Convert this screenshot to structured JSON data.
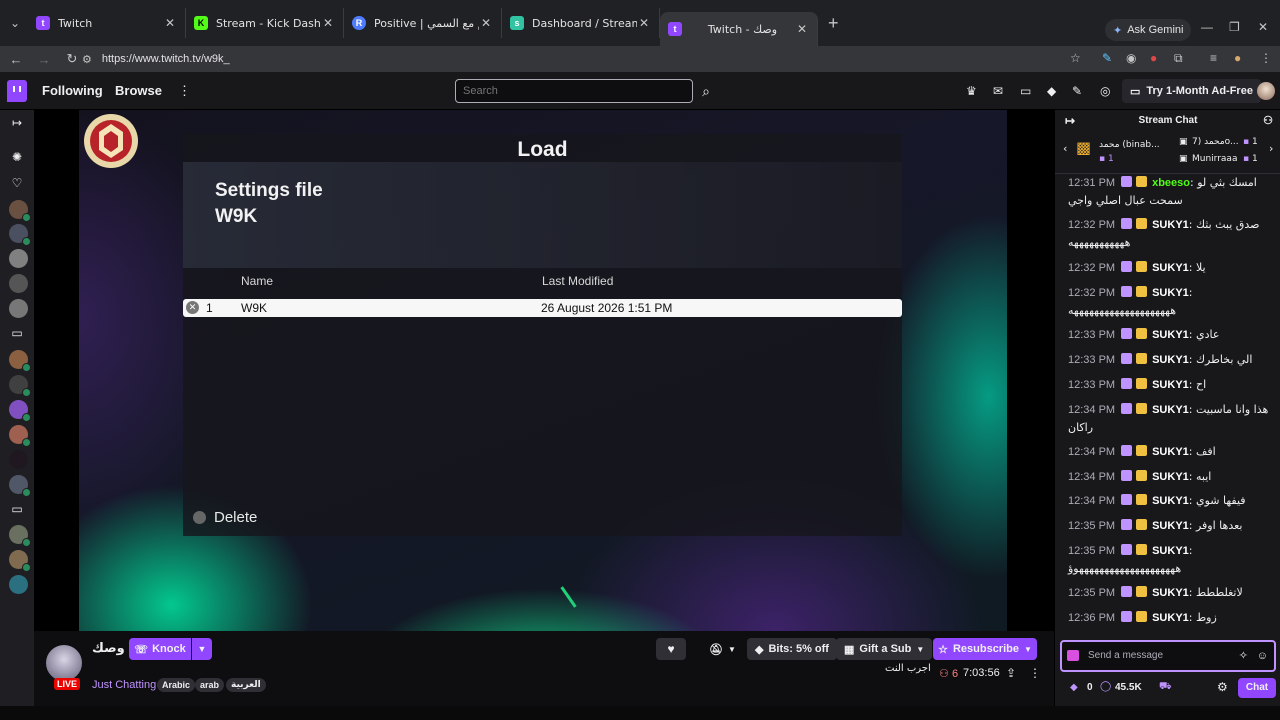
{
  "browser": {
    "tabs": [
      {
        "title": "Twitch",
        "fav_color": "#9147ff",
        "fav_letter": "t"
      },
      {
        "title": "Stream - Kick Dashboard",
        "fav_color": "#53fc18",
        "fav_letter": "K"
      },
      {
        "title": "Positive | النبي تختيم مع السمي",
        "fav_color": "#4f7cff",
        "fav_letter": "R"
      },
      {
        "title": "Dashboard / Streamlabs",
        "fav_color": "#31c3a2",
        "fav_letter": "s"
      },
      {
        "title": "Twitch - وصك",
        "fav_color": "#9147ff",
        "fav_letter": "t"
      }
    ],
    "new_tab": "+",
    "ask_gemini": "Ask Gemini",
    "url": "https://www.twitch.tv/w9k_"
  },
  "twitch_top": {
    "following": "Following",
    "browse": "Browse",
    "search_placeholder": "Search",
    "ad_free": "Try 1-Month Ad-Free"
  },
  "game": {
    "load_title": "Load",
    "settings_title_1": "Settings file",
    "settings_title_2": "W9K",
    "col_name": "Name",
    "col_modified": "Last Modified",
    "row_num": "1",
    "row_name": "W9K",
    "row_date": "26 August 2026 1:51 PM",
    "delete_label": "Delete"
  },
  "stream_info": {
    "streamer_name": "وصك",
    "knock_label": "Knock",
    "live_label": "LIVE",
    "category": "Just Chatting",
    "tags": [
      "Arabic",
      "arab",
      "العربية"
    ],
    "bits_label": "Bits: 5% off",
    "gift_label": "Gift a Sub",
    "resub_label": "Resubscribe",
    "stream_title": "اجرب النت",
    "viewers": "6",
    "uptime": "7:03:56"
  },
  "chat": {
    "header": "Stream Chat",
    "gifters": [
      {
        "name": "محمد (binab...",
        "count": "1"
      },
      {
        "name": "محمد (7o...",
        "count": "1"
      },
      {
        "name": "Munirraaa",
        "count": "1"
      }
    ],
    "messages": [
      {
        "time": "12:31 PM",
        "user": "xbeeso",
        "user_color": "#53fc18",
        "text": "امسك بثي لو سمحت عبال اصلي واجي"
      },
      {
        "time": "12:32 PM",
        "user": "SUKY1",
        "user_color": "#ffffff",
        "text": "صدق يبث بثك هههههههههههه"
      },
      {
        "time": "12:32 PM",
        "user": "SUKY1",
        "user_color": "#ffffff",
        "text": "يلا"
      },
      {
        "time": "12:32 PM",
        "user": "SUKY1",
        "user_color": "#ffffff",
        "text": "ههههههههههههههههههههه"
      },
      {
        "time": "12:33 PM",
        "user": "SUKY1",
        "user_color": "#ffffff",
        "text": "عادي"
      },
      {
        "time": "12:33 PM",
        "user": "SUKY1",
        "user_color": "#ffffff",
        "text": "الي بخاطرك"
      },
      {
        "time": "12:33 PM",
        "user": "SUKY1",
        "user_color": "#ffffff",
        "text": "اح"
      },
      {
        "time": "12:34 PM",
        "user": "SUKY1",
        "user_color": "#ffffff",
        "text": "هذا وانا ماسبيت راكان"
      },
      {
        "time": "12:34 PM",
        "user": "SUKY1",
        "user_color": "#ffffff",
        "text": "افف"
      },
      {
        "time": "12:34 PM",
        "user": "SUKY1",
        "user_color": "#ffffff",
        "text": "ايبه"
      },
      {
        "time": "12:34 PM",
        "user": "SUKY1",
        "user_color": "#ffffff",
        "text": "فيفها شوي"
      },
      {
        "time": "12:35 PM",
        "user": "SUKY1",
        "user_color": "#ffffff",
        "text": "بعدها اوفر"
      },
      {
        "time": "12:35 PM",
        "user": "SUKY1",
        "user_color": "#ffffff",
        "text": "ههههههههههههههههههههوؤ"
      },
      {
        "time": "12:35 PM",
        "user": "SUKY1",
        "user_color": "#ffffff",
        "text": "لاتغلططط"
      },
      {
        "time": "12:36 PM",
        "user": "SUKY1",
        "user_color": "#ffffff",
        "text": "زوط"
      }
    ],
    "input_placeholder": "Send a message",
    "bits_count": "0",
    "points": "45.5K",
    "chat_button": "Chat"
  }
}
